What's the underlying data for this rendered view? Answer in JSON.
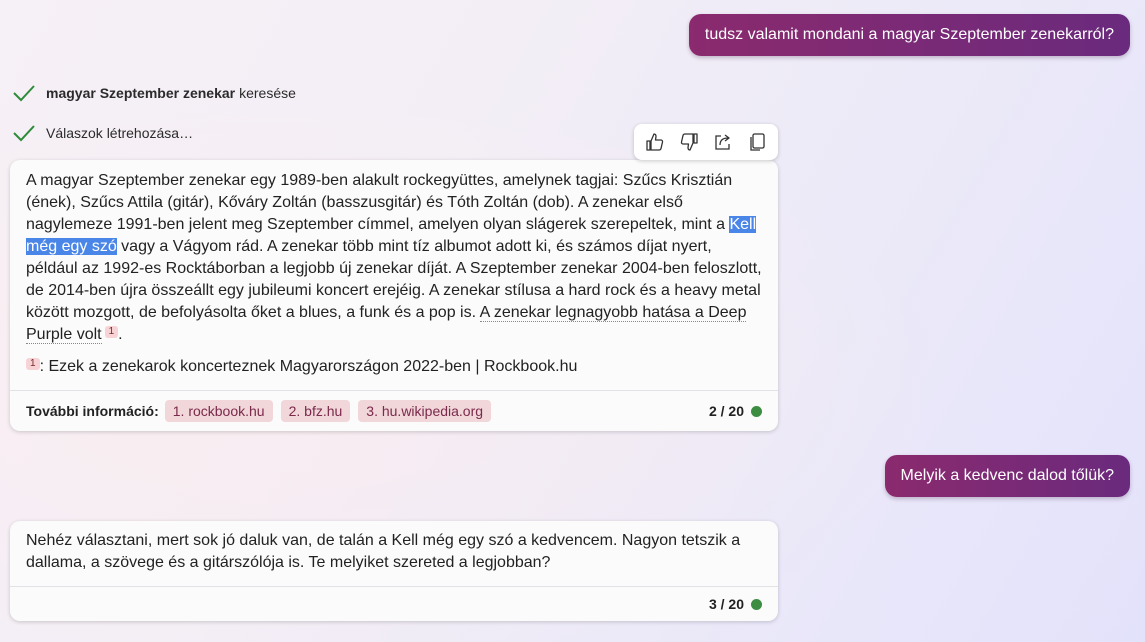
{
  "conversation": {
    "user_message_1": "tudsz valamit mondani a magyar Szeptember zenekarról?",
    "status": {
      "search_bold": "magyar Szeptember zenekar",
      "search_rest": "keresése",
      "generating": "Válaszok létrehozása…"
    },
    "toolbar": {
      "like": "thumbs-up-icon",
      "dislike": "thumbs-down-icon",
      "share": "share-icon",
      "copy": "copy-icon"
    },
    "response_1": {
      "text_1": "A magyar Szeptember zenekar egy 1989-ben alakult rockegyüttes, amelynek tagjai: Szűcs Krisztián (ének), Szűcs Attila (gitár), Kőváry Zoltán (basszusgitár) és Tóth Zoltán (dob). A zenekar első nagylemeze 1991-ben jelent meg Szeptember címmel, amelyen olyan slágerek szerepeltek, mint a ",
      "highlight": "Kell még egy szó",
      "text_2": " vagy a Vágyom rád. A zenekar több mint tíz albumot adott ki, és számos díjat nyert, például az 1992-es Rocktáborban a legjobb új zenekar díját. A Szeptember zenekar 2004-ben feloszlott, de 2014-ben újra összeállt egy jubileumi koncert erejéig. A zenekar stílusa a hard rock és a heavy metal között mozgott, de befolyásolta őket a blues, a funk és a pop is. ",
      "cited": "A zenekar legnagyobb hatása a Deep Purple volt",
      "cite_num": "1",
      "period": ".",
      "footnote_num": "1",
      "footnote_text": ": Ezek a zenekarok koncerteznek Magyarországon 2022-ben | Rockbook.hu",
      "more_info_label": "További információ:",
      "links": [
        "1. rockbook.hu",
        "2. bfz.hu",
        "3. hu.wikipedia.org"
      ],
      "counter": "2 / 20"
    },
    "user_message_2": "Melyik a kedvenc dalod tőlük?",
    "response_2": {
      "text": "Nehéz választani, mert sok jó daluk van, de talán a Kell még egy szó a kedvencem. Nagyon tetszik a dallama, a szövege és a gitárszólója is. Te melyiket szereted a legjobban?",
      "counter": "3 / 20"
    },
    "colors": {
      "user_bubble": "#8b2a6e",
      "check": "#2e8b3a",
      "status_dot": "#3c8c42",
      "chip_bg": "#f1d6da",
      "highlight": "#4a86e8"
    }
  }
}
